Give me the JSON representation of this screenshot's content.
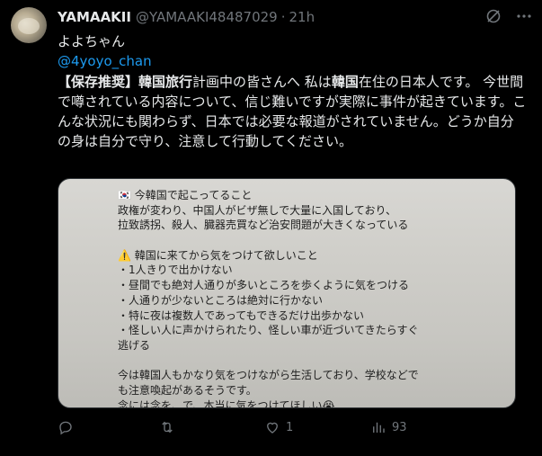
{
  "tweet": {
    "display_name": "YAMAAKII",
    "handle": "@YAMAAKI48487029",
    "separator": "·",
    "time": "21h",
    "reply_text": "よよちゃん",
    "mention": "@4yoyo_chan",
    "body": {
      "p1": "【保存推奨】",
      "p2": "韓国旅行",
      "p3": "計画中の皆さんへ 私は",
      "p4": "韓国",
      "p5": "在住の日本人です。 今世間で噂されている内容について、信じ難いですが実際に事件が起きています。こんな状況にも関わらず、日本では必要な報道がされていません。どうか自分の身は自分で守り、注意して行動してください。"
    },
    "image_lines": [
      "🇰🇷 今韓国で起こってること",
      "政権が変わり、中国人がビザ無しで大量に入国しており、",
      "拉致誘拐、殺人、臓器売買など治安問題が大きくなっている",
      "",
      "⚠️ 韓国に来てから気をつけて欲しいこと",
      "・1人きりで出かけない",
      "・昼間でも絶対人通りが多いところを歩くように気をつける",
      "・人通りが少ないところは絶対に行かない",
      "・特に夜は複数人であってもできるだけ出歩かない",
      "・怪しい人に声かけられたり、怪しい車が近づいてきたらすぐ",
      "逃げる",
      "",
      "今は韓国人もかなり気をつけながら生活しており、学校などで",
      "も注意喚起があるそうです。",
      "念には念を、で、本当に気をつけてほしい😭"
    ],
    "actions": {
      "reply_count": "",
      "retweet_count": "",
      "like_count": "1",
      "views_count": "93"
    }
  },
  "colors": {
    "accent": "#1d9bf0",
    "muted": "#71767b",
    "text": "#e7e9ea",
    "background": "#000000"
  },
  "icons": [
    "grok-icon",
    "more-icon",
    "reply-icon",
    "retweet-icon",
    "like-icon",
    "views-icon"
  ]
}
